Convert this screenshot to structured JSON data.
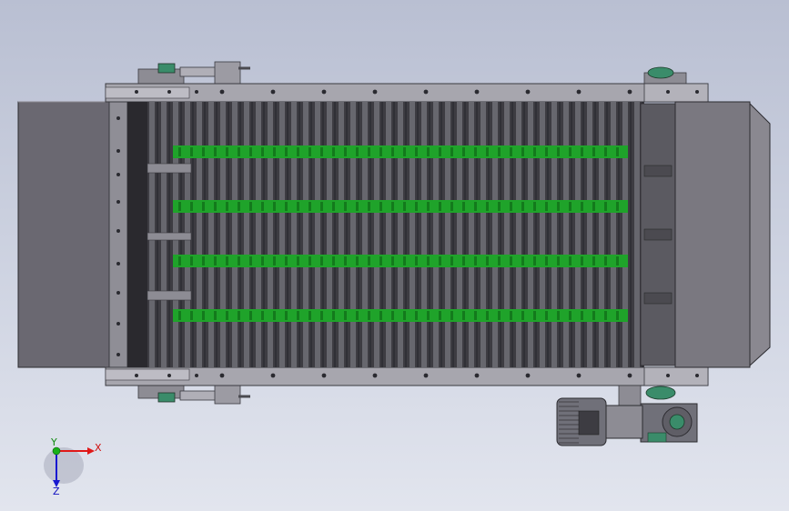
{
  "triad": {
    "x_label": "X",
    "y_label": "Y",
    "z_label": "Z"
  },
  "colors": {
    "background_top": "#b9bfd2",
    "background_bottom": "#e2e5ee",
    "frame_steel": "#9c9ba3",
    "hopper_gray": "#6a6871",
    "belt_dark": "#3d3c42",
    "green_strip": "#1fa32a",
    "motor_housing": "#707079",
    "bearing_green": "#3a8c6a",
    "axis_x": "#e01818",
    "axis_y": "#18b018",
    "axis_z": "#1818d0"
  },
  "components": [
    "left-hopper",
    "conveyor-frame",
    "conveyor-chain",
    "green-chain-strips",
    "right-hopper",
    "tail-tensioners",
    "head-bearings",
    "drive-motor",
    "gear-reducer"
  ]
}
